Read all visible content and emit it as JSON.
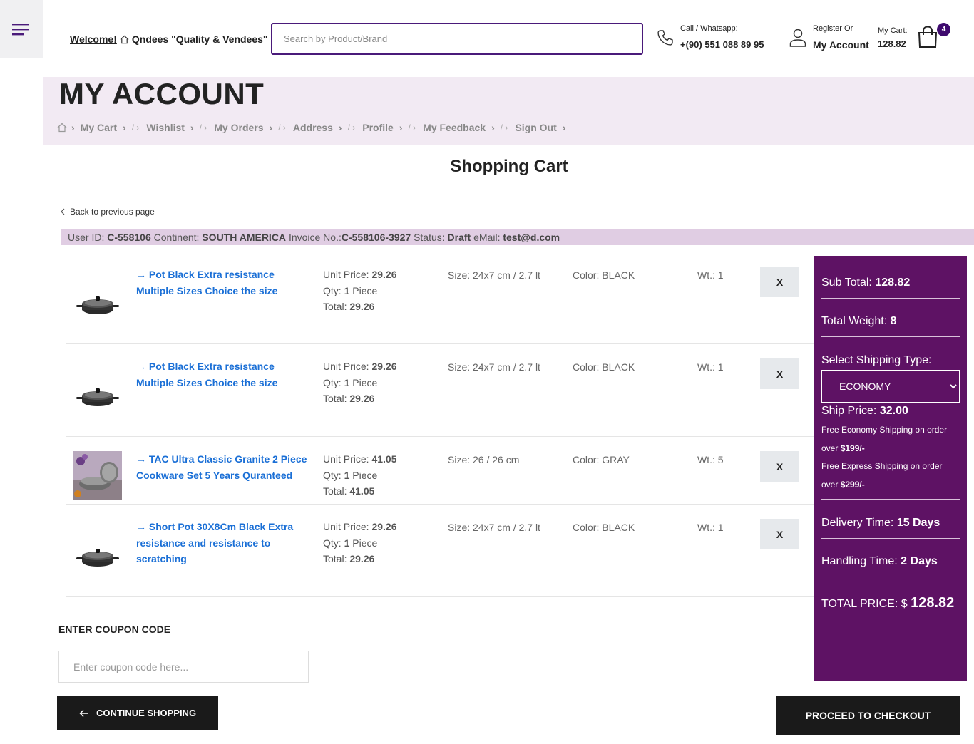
{
  "header": {
    "welcome_label": "Welcome!",
    "store_name": "Qndees \"Quality & Vendees\"",
    "search_placeholder": "Search by Product/Brand",
    "call_label": "Call / Whatsapp:",
    "phone": "+(90) 551 088 89 95",
    "register_label": "Register Or",
    "account_label": "My Account",
    "cart_label": "My Cart:",
    "cart_total": "128.82",
    "cart_count": "4"
  },
  "account": {
    "title": "MY ACCOUNT",
    "breadcrumb": [
      "My Cart",
      "Wishlist",
      "My Orders",
      "Address",
      "Profile",
      "My Feedback",
      "Sign Out"
    ]
  },
  "cart": {
    "title": "Shopping Cart",
    "back_label": "Back to previous page",
    "info": {
      "user_id_label": "User ID:",
      "user_id": "C-558106",
      "continent_label": "Continent:",
      "continent": "SOUTH AMERICA",
      "invoice_label": "Invoice No.:",
      "invoice": "C-558106-3927",
      "status_label": "Status:",
      "status": "Draft",
      "email_label": "eMail:",
      "email": "test@d.com"
    },
    "labels": {
      "unit_price": "Unit Price:",
      "qty": "Qty:",
      "piece": "Piece",
      "total": "Total:",
      "size": "Size:",
      "color": "Color:",
      "wt": "Wt.:",
      "remove": "X"
    },
    "items": [
      {
        "name": "→ Pot Black Extra resistance Multiple Sizes Choice the size",
        "unit_price": "29.26",
        "qty": "1",
        "total": "29.26",
        "size": "24x7 cm / 2.7 lt",
        "color": "BLACK",
        "wt": "1",
        "image": "pot-icon"
      },
      {
        "name": "→ Pot Black Extra resistance Multiple Sizes Choice the size",
        "unit_price": "29.26",
        "qty": "1",
        "total": "29.26",
        "size": "24x7 cm / 2.7 lt",
        "color": "BLACK",
        "wt": "1",
        "image": "pot-icon"
      },
      {
        "name": "→ TAC Ultra Classic Granite 2 Piece Cookware Set 5 Years Quranteed",
        "unit_price": "41.05",
        "qty": "1",
        "total": "41.05",
        "size": "26 / 26 cm",
        "color": "GRAY",
        "wt": "5",
        "image": "cookware-set-photo"
      },
      {
        "name": "→ Short Pot 30X8Cm Black Extra resistance and resistance to scratching",
        "unit_price": "29.26",
        "qty": "1",
        "total": "29.26",
        "size": "24x7 cm / 2.7 lt",
        "color": "BLACK",
        "wt": "1",
        "image": "pot-icon"
      }
    ]
  },
  "summary": {
    "subtotal_label": "Sub Total:",
    "subtotal": "128.82",
    "weight_label": "Total Weight:",
    "weight": "8",
    "shipping_type_label": "Select Shipping Type:",
    "shipping_selected": "ECONOMY",
    "ship_price_label": "Ship Price:",
    "ship_price": "32.00",
    "free_economy": "Free Economy Shipping on order over",
    "free_economy_amount": "$199/-",
    "free_express": "Free Express Shipping on order over",
    "free_express_amount": "$299/-",
    "delivery_label": "Delivery Time:",
    "delivery": "15 Days",
    "handling_label": "Handling Time:",
    "handling": "2 Days",
    "total_label": "TOTAL PRICE: $",
    "total": "128.82",
    "panel_color": "#5e1264"
  },
  "coupon": {
    "title": "ENTER COUPON CODE",
    "placeholder": "Enter coupon code here..."
  },
  "actions": {
    "continue_label": "CONTINUE SHOPPING",
    "checkout_label": "PROCEED TO CHECKOUT"
  }
}
